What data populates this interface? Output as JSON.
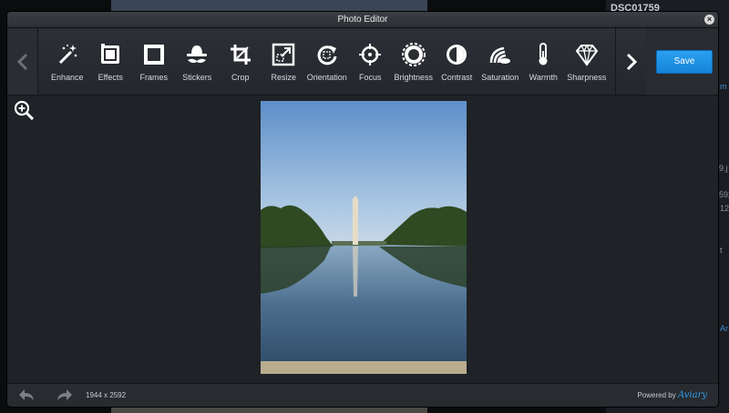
{
  "background": {
    "title": "DSC01759",
    "fragments": [
      "m",
      "9.j",
      "592",
      "12",
      "t",
      "Ar"
    ]
  },
  "window": {
    "title": "Photo Editor",
    "close": "×"
  },
  "toolbar": {
    "tools": [
      {
        "label": "Enhance",
        "icon": "magic-wand-icon"
      },
      {
        "label": "Effects",
        "icon": "film-icon"
      },
      {
        "label": "Frames",
        "icon": "frame-icon"
      },
      {
        "label": "Stickers",
        "icon": "mustache-hat-icon"
      },
      {
        "label": "Crop",
        "icon": "crop-icon"
      },
      {
        "label": "Resize",
        "icon": "resize-icon"
      },
      {
        "label": "Orientation",
        "icon": "rotate-icon"
      },
      {
        "label": "Focus",
        "icon": "focus-icon"
      },
      {
        "label": "Brightness",
        "icon": "sun-icon"
      },
      {
        "label": "Contrast",
        "icon": "contrast-icon"
      },
      {
        "label": "Saturation",
        "icon": "saturation-icon"
      },
      {
        "label": "Warmth",
        "icon": "thermometer-icon"
      },
      {
        "label": "Sharpness",
        "icon": "diamond-icon"
      }
    ],
    "save_label": "Save"
  },
  "footer": {
    "dimensions": "1944 x 2592",
    "powered_by": "Powered by",
    "brand": "Aviary"
  },
  "colors": {
    "accent": "#1f8fe6",
    "panel": "#1f2226"
  }
}
